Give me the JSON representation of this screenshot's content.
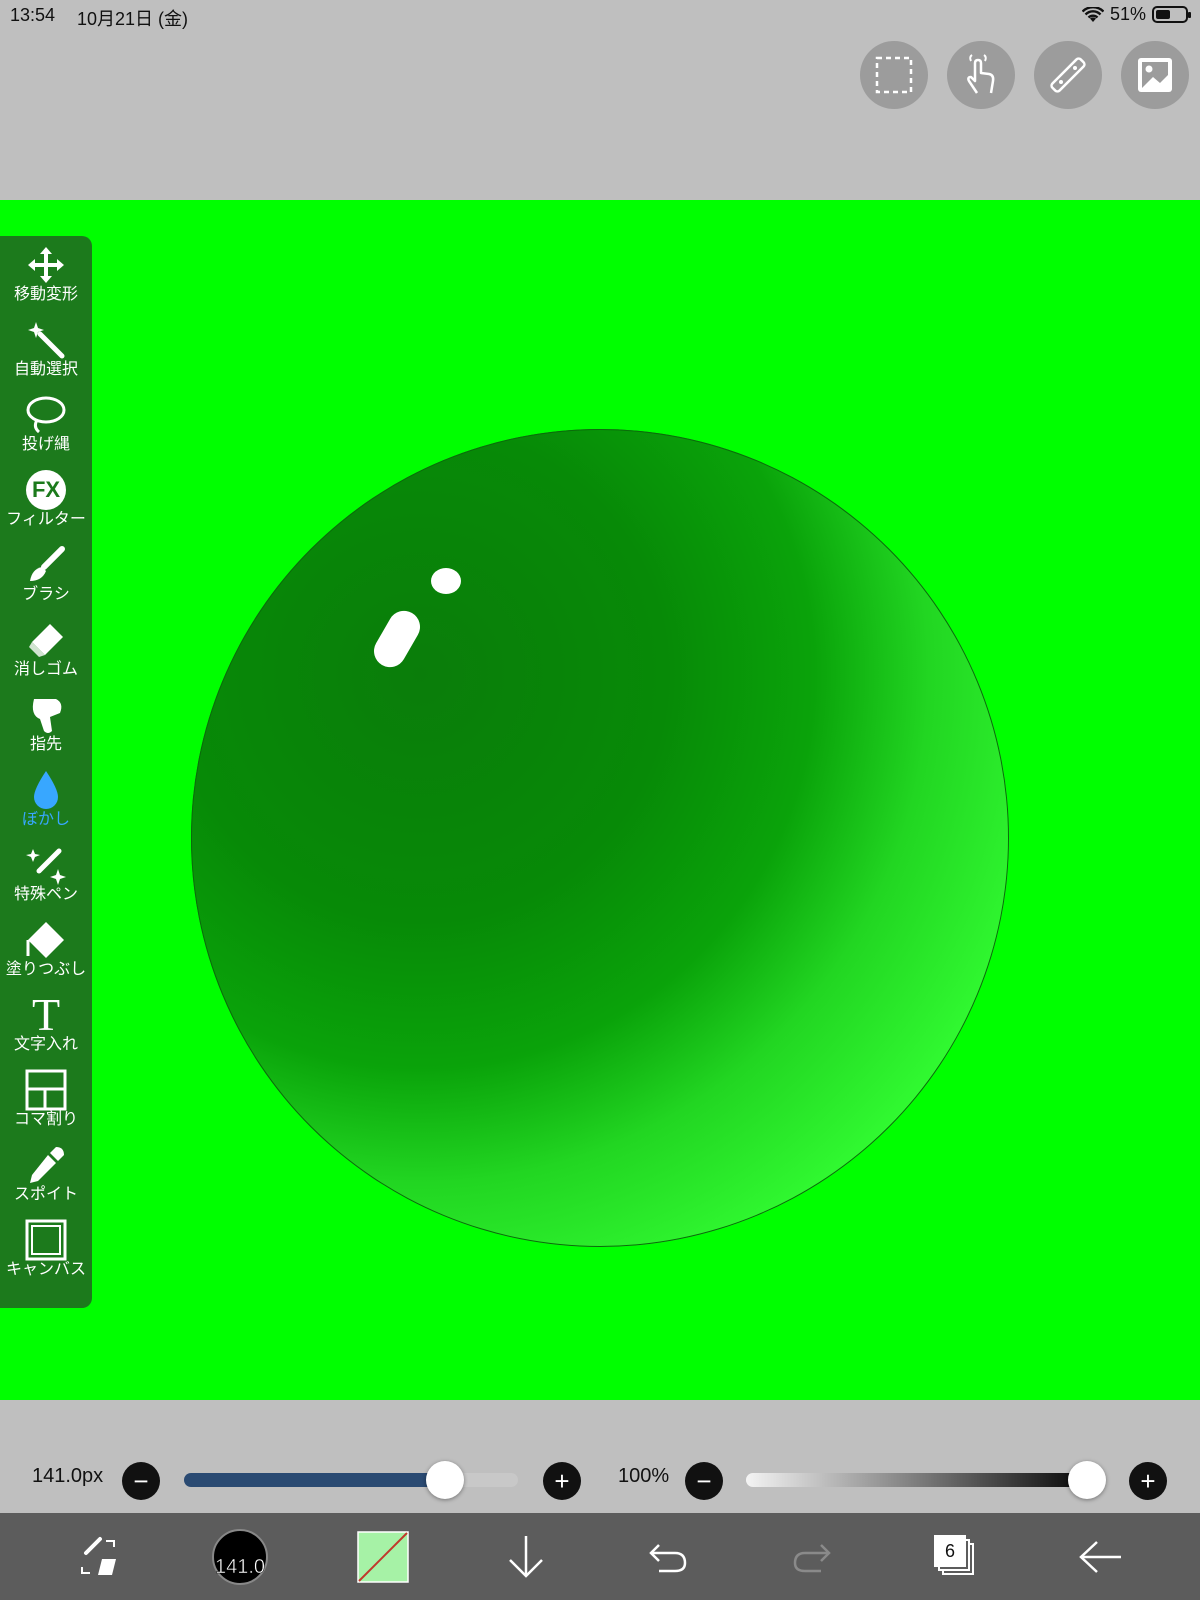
{
  "status_bar": {
    "time": "13:54",
    "date": "10月21日 (金)",
    "battery": "51%"
  },
  "top_buttons": [
    "selection-icon",
    "touch-icon",
    "ruler-icon",
    "image-icon"
  ],
  "tools": [
    {
      "label": "移動変形",
      "icon": "move-transform-icon"
    },
    {
      "label": "自動選択",
      "icon": "magic-wand-icon"
    },
    {
      "label": "投げ縄",
      "icon": "lasso-icon"
    },
    {
      "label": "フィルター",
      "icon": "fx-icon",
      "icon_text": "FX"
    },
    {
      "label": "ブラシ",
      "icon": "brush-icon"
    },
    {
      "label": "消しゴム",
      "icon": "eraser-icon"
    },
    {
      "label": "指先",
      "icon": "finger-icon"
    },
    {
      "label": "ぼかし",
      "icon": "blur-drop-icon",
      "active": true
    },
    {
      "label": "特殊ペン",
      "icon": "special-pen-icon"
    },
    {
      "label": "塗りつぶし",
      "icon": "fill-bucket-icon"
    },
    {
      "label": "文字入れ",
      "icon": "text-icon",
      "icon_text": "T"
    },
    {
      "label": "コマ割り",
      "icon": "frame-divider-icon"
    },
    {
      "label": "スポイト",
      "icon": "eyedropper-icon"
    },
    {
      "label": "キャンバス",
      "icon": "canvas-icon"
    }
  ],
  "brush_size": {
    "label": "141.0px",
    "value": 0.78
  },
  "opacity": {
    "label": "100%",
    "value": 1.0
  },
  "bottom_bar": {
    "brush_preview_size": "141.0",
    "layer_count": "6"
  },
  "colors": {
    "canvas": "#00ff00",
    "toolbar": "#1c7a1c",
    "active_tool": "#38a7ff",
    "size_slider": "#2a4a72",
    "swatch": "#a6f2a6"
  }
}
